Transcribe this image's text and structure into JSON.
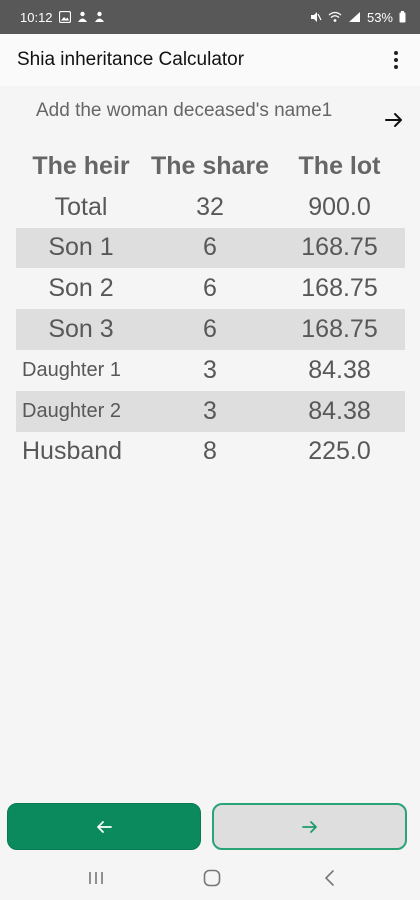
{
  "status_bar": {
    "time": "10:12",
    "battery": "53%"
  },
  "app_bar": {
    "title": "Shia inheritance Calculator"
  },
  "name_field": {
    "placeholder": "Add the woman deceased's name1"
  },
  "table": {
    "headers": [
      "The heir",
      "The share",
      "The lot"
    ],
    "rows": [
      {
        "heir": "Total",
        "share": "32",
        "lot": "900.0"
      },
      {
        "heir": "Son 1",
        "share": "6",
        "lot": "168.75"
      },
      {
        "heir": "Son 2",
        "share": "6",
        "lot": "168.75"
      },
      {
        "heir": "Son 3",
        "share": "6",
        "lot": "168.75"
      },
      {
        "heir": "Daughter 1",
        "share": "3",
        "lot": "84.38"
      },
      {
        "heir": "Daughter 2",
        "share": "3",
        "lot": "84.38"
      },
      {
        "heir": "Husband",
        "share": "8",
        "lot": "225.0"
      }
    ]
  },
  "colors": {
    "primary_green": "#0b8a5e",
    "outline_green": "#2aa376",
    "row_shade": "#dedede",
    "status_bar": "#585858"
  },
  "icons": {
    "next_arrow": "arrow-right-icon",
    "overflow": "more-vert-icon",
    "back_button": "arrow-left-icon",
    "forward_button": "arrow-right-icon"
  }
}
